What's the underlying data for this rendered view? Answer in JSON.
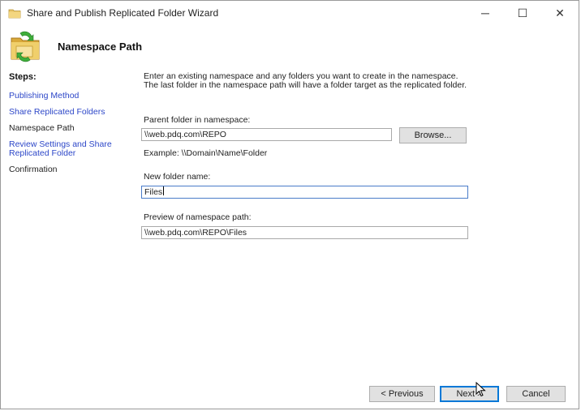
{
  "window": {
    "title": "Share and Publish Replicated Folder Wizard",
    "minimize_glyph": "─",
    "maximize_glyph": "☐",
    "close_glyph": "✕"
  },
  "header": {
    "title": "Namespace Path",
    "icon": "shared-folders-icon"
  },
  "sidebar": {
    "heading": "Steps:",
    "items": [
      {
        "label": "Publishing Method",
        "state": "link"
      },
      {
        "label": "Share Replicated Folders",
        "state": "link"
      },
      {
        "label": "Namespace Path",
        "state": "current"
      },
      {
        "label": "Review Settings and Share Replicated Folder",
        "state": "link"
      },
      {
        "label": "Confirmation",
        "state": "pending"
      }
    ]
  },
  "main": {
    "intro": "Enter an existing namespace and any folders you want to create in the namespace. The last folder in the namespace path will have a folder target as the replicated folder.",
    "parent_label": "Parent folder in namespace:",
    "parent_value": "\\\\web.pdq.com\\REPO",
    "browse_label": "Browse...",
    "example_text": "Example:  \\\\Domain\\Name\\Folder",
    "new_folder_label": "New folder name:",
    "new_folder_value": "Files",
    "preview_label": "Preview of namespace path:",
    "preview_value": "\\\\web.pdq.com\\REPO\\Files"
  },
  "footer": {
    "previous_label": "< Previous",
    "next_label": "Next >",
    "cancel_label": "Cancel"
  },
  "colors": {
    "link": "#2d47c8",
    "focus_border": "#4a7cc9",
    "default_button_border": "#0078d7"
  }
}
